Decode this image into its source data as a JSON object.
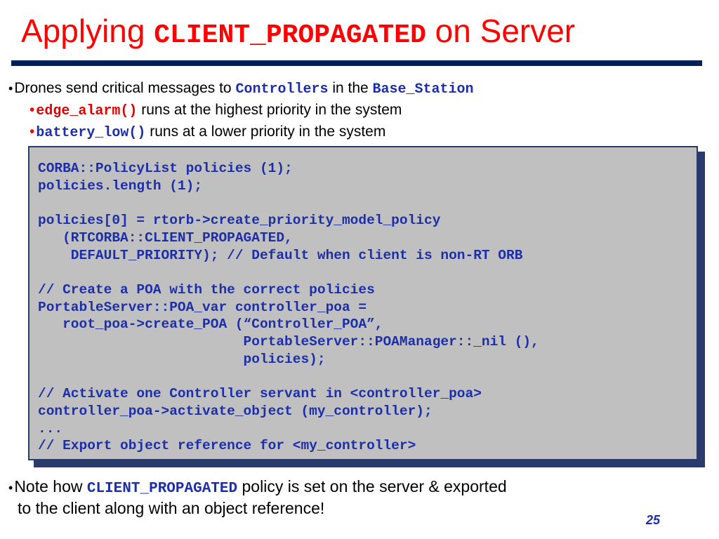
{
  "title": {
    "prefix": "Applying ",
    "code": "CLIENT_PROPAGATED",
    "suffix": " on Server"
  },
  "colors": {
    "title": "#ff0000",
    "rule": "#00205c",
    "code_blue": "#1c2fa8",
    "code_red": "#e00000",
    "code_box_bg": "#c0c0c0"
  },
  "bullets": {
    "first": {
      "text_a": "Drones send critical messages to ",
      "code_a": "Controllers",
      "text_b": " in the ",
      "code_b": "Base_Station"
    },
    "sub1": {
      "code": "edge_alarm()",
      "text": " runs at the highest priority in the system"
    },
    "sub2": {
      "code": "battery_low()",
      "text": " runs at a lower priority in the system"
    }
  },
  "code_block": "CORBA::PolicyList policies (1);\npolicies.length (1);\n\npolicies[0] = rtorb->create_priority_model_policy\n   (RTCORBA::CLIENT_PROPAGATED,\n    DEFAULT_PRIORITY); // Default when client is non-RT ORB\n\n// Create a POA with the correct policies\nPortableServer::POA_var controller_poa =\n   root_poa->create_POA (“Controller_POA”,\n                         PortableServer::POAManager::_nil (),\n                         policies);\n\n// Activate one Controller servant in <controller_poa>\ncontroller_poa->activate_object (my_controller);\n...\n// Export object reference for <my_controller>",
  "note": {
    "text_a": "Note how ",
    "code": "CLIENT_PROPAGATED",
    "text_b": " policy is set on the server & exported",
    "line2": "to the client along with an object reference!"
  },
  "page_number": "25"
}
